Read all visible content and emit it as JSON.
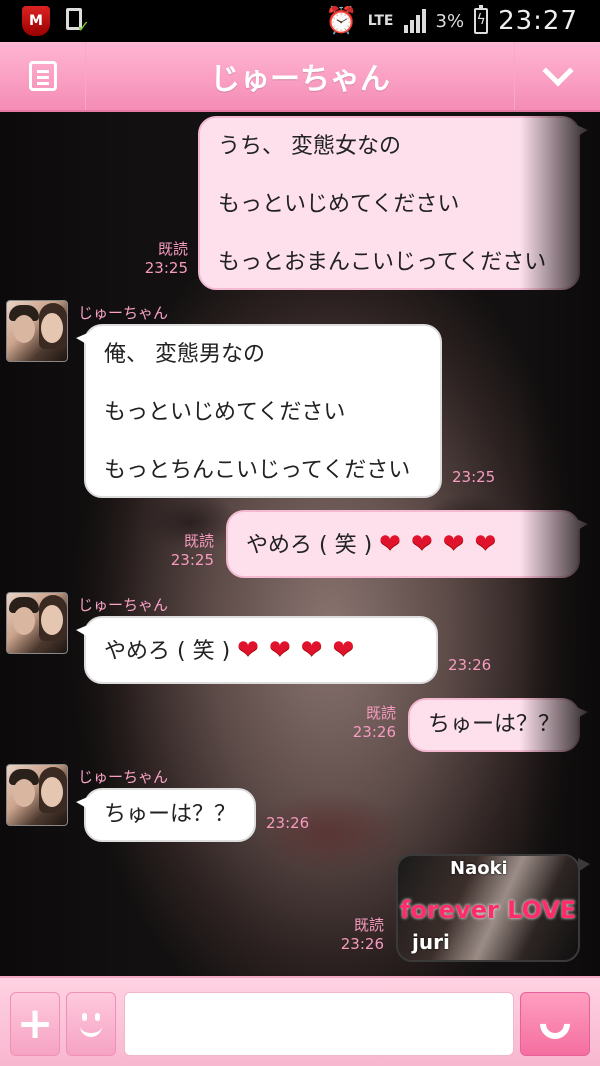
{
  "status_bar": {
    "icons": [
      "mcafee-icon",
      "download-complete-icon",
      "alarm-icon",
      "signal-icon",
      "battery-charging-icon"
    ],
    "network": "LTE",
    "battery": "3%",
    "time": "23:27"
  },
  "header": {
    "title": "じゅーちゃん",
    "left_icon": "menu-icon",
    "right_icon": "chevron-down-icon"
  },
  "messages": [
    {
      "direction": "out",
      "lines": [
        "うち、 変態女なの",
        "もっといじめてください",
        "もっとおまんこいじってください"
      ],
      "read": "既読",
      "time": "23:25"
    },
    {
      "direction": "in",
      "sender": "じゅーちゃん",
      "lines": [
        "俺、 変態男なの",
        "もっといじめてください",
        "もっとちんこいじってください"
      ],
      "time": "23:25"
    },
    {
      "direction": "out",
      "text": "やめろ ( 笑 )",
      "hearts": "❤❤❤❤",
      "read": "既読",
      "time": "23:25"
    },
    {
      "direction": "in",
      "sender": "じゅーちゃん",
      "text": "やめろ ( 笑 )",
      "hearts": "❤❤❤❤",
      "time": "23:26"
    },
    {
      "direction": "out",
      "text": "ちゅーは？？",
      "read": "既読",
      "time": "23:26"
    },
    {
      "direction": "in",
      "sender": "じゅーちゃん",
      "text": "ちゅーは？？",
      "time": "23:26"
    },
    {
      "direction": "out",
      "type": "image",
      "image_text": {
        "top": "Naoki",
        "middle": "forever LOVE",
        "bottom": "juri"
      },
      "read": "既読",
      "time": "23:26"
    }
  ],
  "input_bar": {
    "plus": "+",
    "placeholder": "",
    "icons": [
      "plus-icon",
      "emoji-icon",
      "phone-icon"
    ]
  },
  "colors": {
    "header_pink": "#f58cb6",
    "bubble_out": "#fde0ec",
    "bubble_in": "#ffffff",
    "meta_pink": "#f79bc0"
  }
}
